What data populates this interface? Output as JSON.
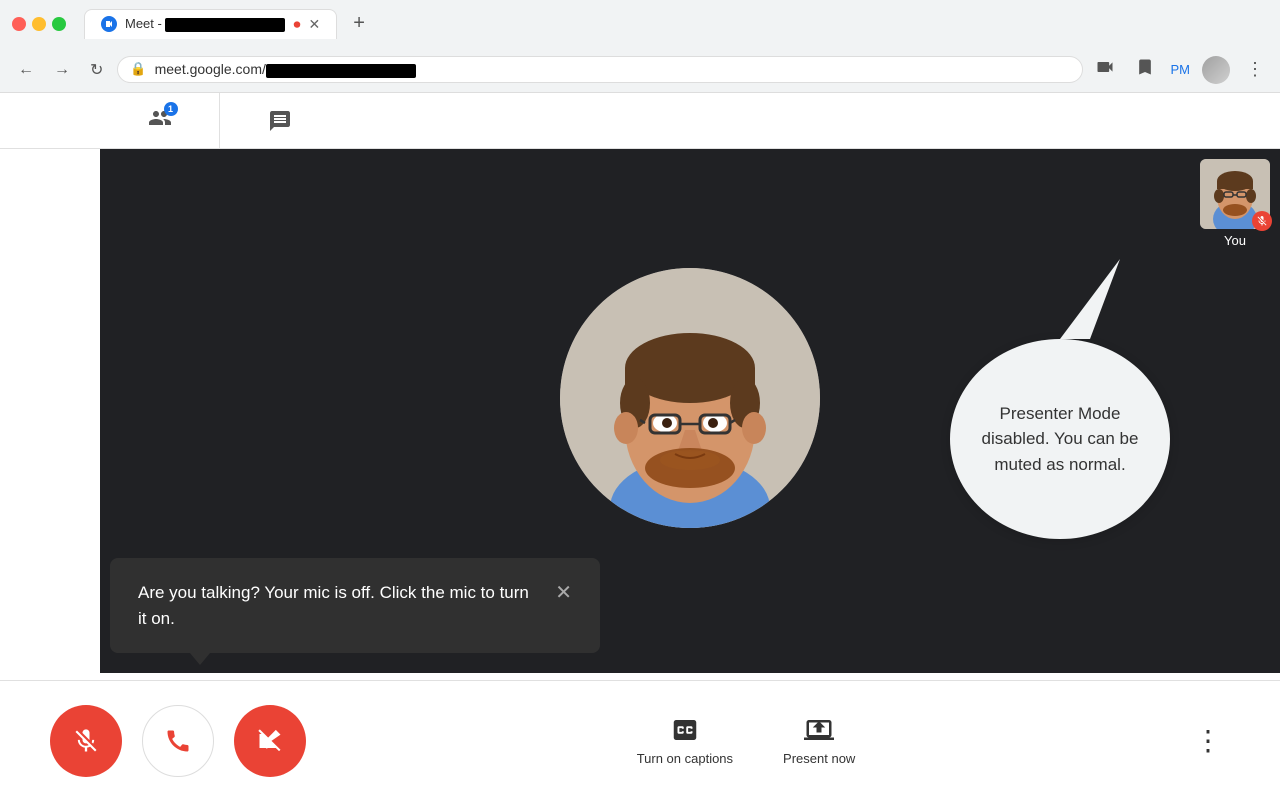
{
  "browser": {
    "tab": {
      "title": "Meet - ",
      "icon": "meet-icon",
      "redacted": true
    },
    "address": "meet.google.com/",
    "address_redacted": true,
    "profile_text": "PM",
    "new_tab": "+"
  },
  "toolbar": {
    "participants_count": "1",
    "you_label": "You"
  },
  "tooltip": {
    "text": "Presenter Mode disabled. You can be muted as normal."
  },
  "toast": {
    "message": "Are you talking? Your mic is off. Click the mic to turn it on."
  },
  "controls": {
    "mute_label": "Mute",
    "hangup_label": "End call",
    "camera_label": "Camera",
    "captions_label": "Turn on captions",
    "present_label": "Present now",
    "more_label": "More options"
  }
}
